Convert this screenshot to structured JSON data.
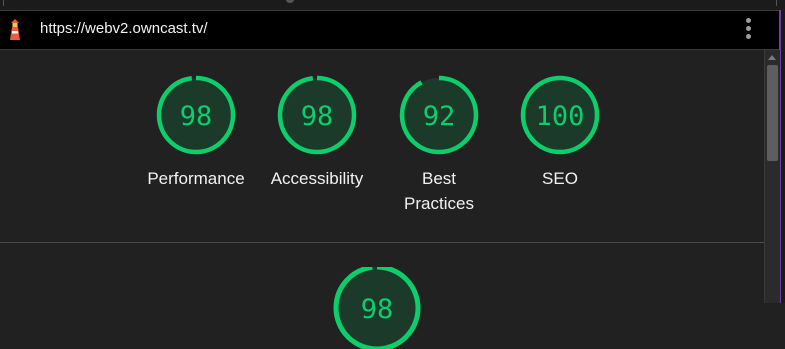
{
  "browser": {
    "url": "https://webv2.owncast.tv/"
  },
  "colors": {
    "pass": "#0cce6b",
    "pass_fill": "#1c3a2a",
    "accent_edge": "#6e3fa1"
  },
  "icons": {
    "site": "lighthouse-icon",
    "menu": "kebab-menu-icon"
  },
  "scores": [
    {
      "value": "98",
      "label": "Performance"
    },
    {
      "value": "98",
      "label": "Accessibility"
    },
    {
      "value": "92",
      "label": "Best Practices"
    },
    {
      "value": "100",
      "label": "SEO"
    }
  ],
  "pwa_score": {
    "value": "98"
  }
}
